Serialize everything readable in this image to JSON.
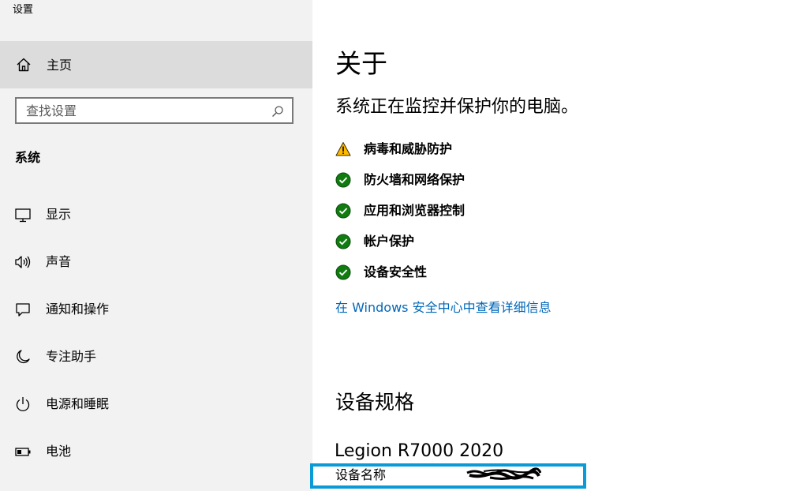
{
  "window": {
    "title": "设置"
  },
  "sidebar": {
    "home_label": "主页",
    "home_icon": "home-icon",
    "search_placeholder": "查找设置",
    "search_icon": "search-icon",
    "section_title": "系统",
    "items": [
      {
        "label": "显示",
        "icon": "monitor-icon"
      },
      {
        "label": "声音",
        "icon": "speaker-icon"
      },
      {
        "label": "通知和操作",
        "icon": "notification-icon"
      },
      {
        "label": "专注助手",
        "icon": "moon-icon"
      },
      {
        "label": "电源和睡眠",
        "icon": "power-icon"
      },
      {
        "label": "电池",
        "icon": "battery-icon"
      }
    ]
  },
  "main": {
    "title": "关于",
    "status_headline": "系统正在监控并保护你的电脑。",
    "status_items": [
      {
        "label": "病毒和威胁防护",
        "status": "warning",
        "icon": "warning-icon"
      },
      {
        "label": "防火墙和网络保护",
        "status": "ok",
        "icon": "check-circle-icon"
      },
      {
        "label": "应用和浏览器控制",
        "status": "ok",
        "icon": "check-circle-icon"
      },
      {
        "label": "帐户保护",
        "status": "ok",
        "icon": "check-circle-icon"
      },
      {
        "label": "设备安全性",
        "status": "ok",
        "icon": "check-circle-icon"
      }
    ],
    "details_link": "在 Windows 安全中心中查看详细信息",
    "specs_heading": "设备规格",
    "device_model": "Legion R7000 2020",
    "device_name_label": "设备名称"
  },
  "colors": {
    "sidebar_bg": "#f2f2f2",
    "selected_bg": "#dcdcdc",
    "link": "#0067b8",
    "ok": "#107c10",
    "warning": "#ffb900",
    "highlight": "#0a9bd7"
  }
}
